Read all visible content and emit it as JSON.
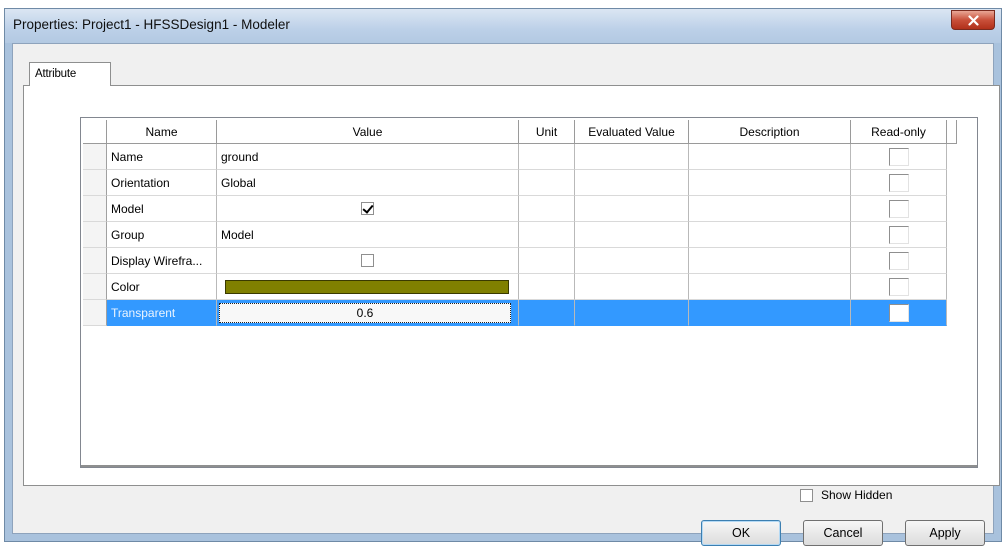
{
  "window": {
    "title": "Properties: Project1 - HFSSDesign1 - Modeler",
    "close_label": "x"
  },
  "tabs": [
    {
      "label": "Attribute"
    }
  ],
  "grid": {
    "columns": [
      "Name",
      "Value",
      "Unit",
      "Evaluated Value",
      "Description",
      "Read-only"
    ],
    "rows": [
      {
        "name": "Name",
        "value": "ground",
        "value_type": "text",
        "readonly": false
      },
      {
        "name": "Orientation",
        "value": "Global",
        "value_type": "text",
        "readonly": false
      },
      {
        "name": "Model",
        "value": true,
        "value_type": "checkbox",
        "readonly": false
      },
      {
        "name": "Group",
        "value": "Model",
        "value_type": "text",
        "readonly": false
      },
      {
        "name": "Display Wirefra...",
        "value": false,
        "value_type": "checkbox",
        "readonly": false
      },
      {
        "name": "Color",
        "value": "#808000",
        "value_type": "color",
        "readonly": false
      },
      {
        "name": "Transparent",
        "value": "0.6",
        "value_type": "edit",
        "readonly": false,
        "selected": true
      }
    ]
  },
  "show_hidden": {
    "label": "Show Hidden",
    "checked": false
  },
  "buttons": {
    "ok": "OK",
    "cancel": "Cancel",
    "apply": "Apply"
  },
  "colors": {
    "selection": "#3399ff",
    "object_color": "#808000"
  }
}
